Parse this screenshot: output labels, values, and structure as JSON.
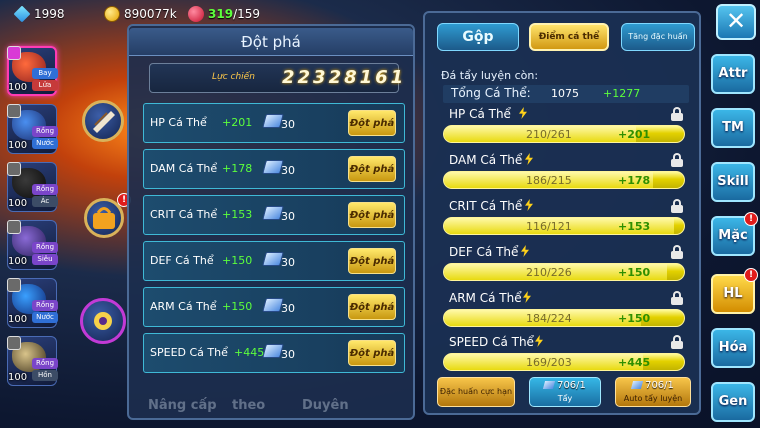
{
  "status": {
    "diamonds": "1998",
    "gold": "890077k",
    "stamina": "319",
    "stamina_max": "/159"
  },
  "pokemon_list": [
    {
      "level": "100",
      "tag1": "Bay",
      "tag2": "Lửa"
    },
    {
      "level": "100",
      "tag1": "Rồng",
      "tag2": "Nước"
    },
    {
      "level": "100",
      "tag1": "Rồng",
      "tag2": "Ác"
    },
    {
      "level": "100",
      "tag1": "Rồng",
      "tag2": "Siêu"
    },
    {
      "level": "100",
      "tag1": "Rồng",
      "tag2": "Nước"
    },
    {
      "level": "100",
      "tag1": "Rồng",
      "tag2": "Hồn"
    }
  ],
  "breakthrough": {
    "title": "Đột phá",
    "power_label": "Lực chiến",
    "power_value": "22328161",
    "rows": [
      {
        "name": "HP Cá Thể",
        "bonus": "+201",
        "cost": "30",
        "button": "Đột phá"
      },
      {
        "name": "DAM Cá Thể",
        "bonus": "+178",
        "cost": "30",
        "button": "Đột phá"
      },
      {
        "name": "CRIT Cá Thể",
        "bonus": "+153",
        "cost": "30",
        "button": "Đột phá"
      },
      {
        "name": "DEF Cá Thể",
        "bonus": "+150",
        "cost": "30",
        "button": "Đột phá"
      },
      {
        "name": "ARM Cá Thể",
        "bonus": "+150",
        "cost": "30",
        "button": "Đột phá"
      },
      {
        "name": "SPEED Cá Thể",
        "bonus": "+445",
        "cost": "30",
        "button": "Đột phá"
      }
    ]
  },
  "stats_panel": {
    "tabs": [
      "Gộp",
      "Điểm cá thể",
      "Tăng đặc huấn"
    ],
    "remaining_label": "Đá tẩy luyện còn:",
    "total_label": "Tổng Cá Thể:",
    "total_value": "1075",
    "total_bonus": "+1277",
    "stats": [
      {
        "name": "HP Cá Thể",
        "value": "210/261",
        "bonus": "+201",
        "fraction": 0.8
      },
      {
        "name": "DAM Cá Thể",
        "value": "186/215",
        "bonus": "+178",
        "fraction": 0.87
      },
      {
        "name": "CRIT Cá Thể",
        "value": "116/121",
        "bonus": "+153",
        "fraction": 0.96
      },
      {
        "name": "DEF Cá Thể",
        "value": "210/226",
        "bonus": "+150",
        "fraction": 0.93
      },
      {
        "name": "ARM Cá Thể",
        "value": "184/224",
        "bonus": "+150",
        "fraction": 0.82
      },
      {
        "name": "SPEED Cá Thể",
        "value": "169/203",
        "bonus": "+445",
        "fraction": 0.83
      }
    ],
    "buttons": {
      "special_training": "Đặc huấn cực hạn",
      "wash_count": "706/1",
      "wash_label": "Tẩy",
      "auto_count": "706/1",
      "auto_label": "Auto tẩy luyện"
    }
  },
  "nav": {
    "close": "✕",
    "items": [
      "Attr",
      "TM",
      "Skill",
      "Mặc",
      "HL",
      "Hóa",
      "Gen"
    ]
  },
  "ghost_labels": [
    "Nâng cấp",
    "theo",
    "Duyên"
  ],
  "colors": {
    "accent_green": "#5cff3c",
    "gold_button": "#ffe86a",
    "panel_bg": "#1c2d4e",
    "nav_blue": "#3bb6e7",
    "nav_active": "#ffd94a"
  }
}
